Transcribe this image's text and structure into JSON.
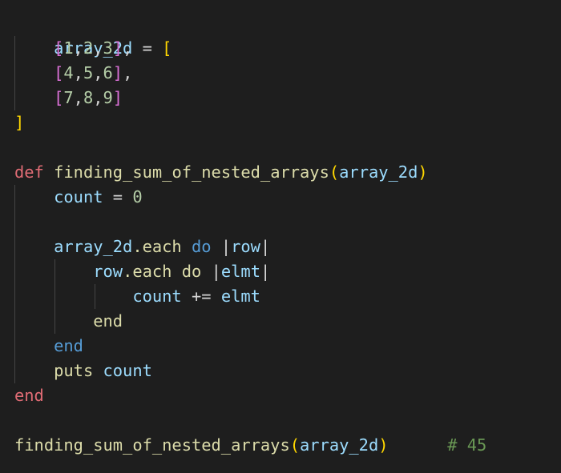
{
  "code": {
    "array_var": "array_2d",
    "assign_op": " = ",
    "open_bracket": "[",
    "close_bracket": "]",
    "rows": [
      {
        "open": "[",
        "nums": [
          "1",
          "2",
          "3"
        ],
        "close": "]",
        "trail": ","
      },
      {
        "open": "[",
        "nums": [
          "4",
          "5",
          "6"
        ],
        "close": "]",
        "trail": ","
      },
      {
        "open": "[",
        "nums": [
          "7",
          "8",
          "9"
        ],
        "close": "]",
        "trail": ""
      }
    ],
    "comma": ",",
    "def_kw": "def",
    "fn_name": "finding_sum_of_nested_arrays",
    "paren_open": "(",
    "param": "array_2d",
    "paren_close": ")",
    "count_var": "count",
    "zero": "0",
    "each_method": ".each",
    "do_kw": "do",
    "pipe": "|",
    "row_var": "row",
    "elmt_var": "elmt",
    "plus_eq": " += ",
    "end_kw": "end",
    "puts_fn": "puts",
    "comment": "# 45"
  }
}
